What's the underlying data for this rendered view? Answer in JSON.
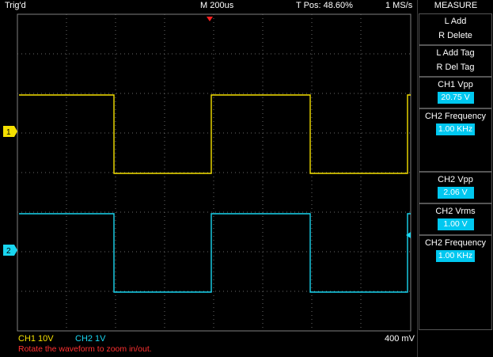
{
  "header": {
    "trigger_status": "Trig'd",
    "timebase": "M 200us",
    "trigger_pos": "T Pos: 48.60%",
    "sample_rate": "1 MS/s"
  },
  "menu": {
    "title": "MEASURE",
    "add_delete": {
      "line1": "L Add",
      "line2": "R Delete"
    },
    "tag": {
      "line1": "L Add Tag",
      "line2": "R Del Tag"
    },
    "measurements": [
      {
        "label": "CH1 Vpp",
        "value": "20.75 V"
      },
      {
        "label": "CH2 Frequency",
        "value": "1.00 KHz"
      },
      {
        "label": "CH2 Vpp",
        "value": "2.06 V"
      },
      {
        "label": "CH2 Vrms",
        "value": "1.00 V"
      },
      {
        "label": "CH2 Frequency",
        "value": "1.00 KHz"
      }
    ]
  },
  "footer": {
    "ch1_scale": "CH1  10V",
    "ch2_scale": "CH2  1V",
    "trigger_level": "400 mV",
    "hint": "Rotate the waveform to zoom in/out."
  },
  "channels": {
    "ch1": {
      "label": "1",
      "color": "#f5e000"
    },
    "ch2": {
      "label": "2",
      "color": "#19d6f0"
    }
  },
  "trigger_marker_color": "#ff2020"
}
